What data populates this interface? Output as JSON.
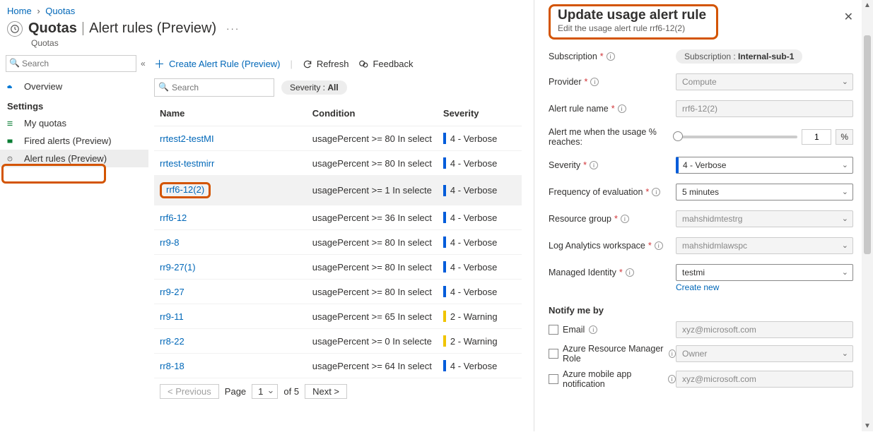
{
  "breadcrumb": {
    "home": "Home",
    "quotas": "Quotas"
  },
  "header": {
    "title": "Quotas",
    "subtitle": "Alert rules (Preview)",
    "subtext": "Quotas",
    "more": "···"
  },
  "sidebar": {
    "search_ph": "Search",
    "collapse": "«",
    "overview": "Overview",
    "settings": "Settings",
    "items": [
      {
        "label": "My quotas"
      },
      {
        "label": "Fired alerts (Preview)"
      },
      {
        "label": "Alert rules (Preview)"
      }
    ]
  },
  "toolbar": {
    "create": "Create Alert Rule (Preview)",
    "refresh": "Refresh",
    "feedback": "Feedback"
  },
  "filters": {
    "search_ph": "Search",
    "pill_label": "Severity : ",
    "pill_value": "All"
  },
  "table": {
    "cols": {
      "name": "Name",
      "condition": "Condition",
      "severity": "Severity"
    },
    "rows": [
      {
        "name": "rrtest2-testMI",
        "condition": "usagePercent >= 80 In select",
        "sev": "4 - Verbose",
        "warn": false
      },
      {
        "name": "rrtest-testmirr",
        "condition": "usagePercent >= 80 In select",
        "sev": "4 - Verbose",
        "warn": false
      },
      {
        "name": "rrf6-12(2)",
        "condition": "usagePercent >= 1 In selecte",
        "sev": "4 - Verbose",
        "warn": false,
        "selected": true,
        "highlight": true
      },
      {
        "name": "rrf6-12",
        "condition": "usagePercent >= 36 In select",
        "sev": "4 - Verbose",
        "warn": false
      },
      {
        "name": "rr9-8",
        "condition": "usagePercent >= 80 In select",
        "sev": "4 - Verbose",
        "warn": false
      },
      {
        "name": "rr9-27(1)",
        "condition": "usagePercent >= 80 In select",
        "sev": "4 - Verbose",
        "warn": false
      },
      {
        "name": "rr9-27",
        "condition": "usagePercent >= 80 In select",
        "sev": "4 - Verbose",
        "warn": false
      },
      {
        "name": "rr9-11",
        "condition": "usagePercent >= 65 In select",
        "sev": "2 - Warning",
        "warn": true
      },
      {
        "name": "rr8-22",
        "condition": "usagePercent >= 0 In selecte",
        "sev": "2 - Warning",
        "warn": true
      },
      {
        "name": "rr8-18",
        "condition": "usagePercent >= 64 In select",
        "sev": "4 - Verbose",
        "warn": false
      }
    ]
  },
  "pager": {
    "prev": "< Previous",
    "page_label": "Page",
    "page": "1",
    "of": "of 5",
    "next": "Next >"
  },
  "panel": {
    "title": "Update usage alert rule",
    "sub": "Edit the usage alert rule rrf6-12(2)",
    "subscription_lbl": "Subscription",
    "subscription_pill_lbl": "Subscription : ",
    "subscription_pill_val": "Internal-sub-1",
    "provider_lbl": "Provider",
    "provider_val": "Compute",
    "alert_name_lbl": "Alert rule name",
    "alert_name_val": "rrf6-12(2)",
    "slider_lbl": "Alert me when the usage % reaches:",
    "slider_val": "1",
    "pct": "%",
    "severity_lbl": "Severity",
    "severity_val": "4 - Verbose",
    "freq_lbl": "Frequency of evaluation",
    "freq_val": "5 minutes",
    "rg_lbl": "Resource group",
    "rg_val": "mahshidmtestrg",
    "law_lbl": "Log Analytics workspace",
    "law_val": "mahshidmlawspc",
    "mi_lbl": "Managed Identity",
    "mi_val": "testmi",
    "create_new": "Create new",
    "notify_h": "Notify me by",
    "notify_email": "Email",
    "notify_email_ph": "xyz@microsoft.com",
    "notify_arm": "Azure Resource Manager Role",
    "notify_arm_val": "Owner",
    "notify_app": "Azure mobile app notification",
    "notify_app_ph": "xyz@microsoft.com"
  }
}
